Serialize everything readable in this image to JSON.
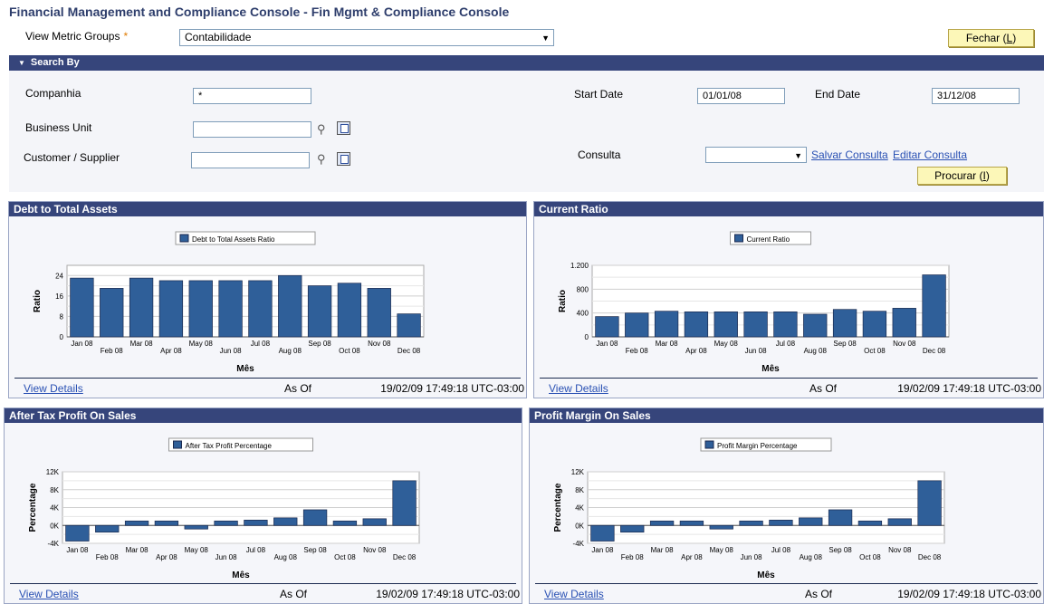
{
  "page_title": "Financial Management and Compliance Console - Fin Mgmt & Compliance Console",
  "metric_groups": {
    "label": "View Metric Groups",
    "required_mark": "*",
    "selected": "Contabilidade"
  },
  "close_button": {
    "label": "Fechar (",
    "key": "L",
    "suffix": ")"
  },
  "search": {
    "header": "Search By",
    "companhia_label": "Companhia",
    "companhia_value": "*",
    "business_unit_label": "Business Unit",
    "business_unit_value": "",
    "customer_label": "Customer / Supplier",
    "customer_value": "",
    "start_date_label": "Start Date",
    "start_date_value": "01/01/08",
    "end_date_label": "End Date",
    "end_date_value": "31/12/08",
    "consulta_label": "Consulta",
    "consulta_value": "",
    "save_query": "Salvar Consulta",
    "edit_query": "Editar Consulta",
    "search_button": {
      "label": "Procurar (",
      "key": "I",
      "suffix": ")"
    }
  },
  "icons": {
    "lookup": "magnifier-icon",
    "edit": "edit-icon",
    "dropdown": "chevron-down-icon",
    "collapse": "triangle-down-icon"
  },
  "colors": {
    "header_bg": "#36457b",
    "bar": "#2f5f99",
    "button_bg": "#fcf7b8",
    "link": "#2950b3"
  },
  "chart_data": [
    {
      "type": "bar",
      "title": "Debt to Total Assets",
      "legend": "Debt to Total Assets Ratio",
      "xlabel": "Mês",
      "ylabel": "Ratio",
      "categories": [
        "Jan 08",
        "Feb 08",
        "Mar 08",
        "Apr 08",
        "May 08",
        "Jun 08",
        "Jul 08",
        "Aug 08",
        "Sep 08",
        "Oct 08",
        "Nov 08",
        "Dec 08"
      ],
      "values": [
        23,
        19,
        23,
        22,
        22,
        22,
        22,
        24,
        20,
        21,
        19,
        9
      ],
      "ylim": [
        0,
        28
      ],
      "yticks": [
        "0",
        "8",
        "16",
        "24"
      ],
      "ytick_values": [
        0,
        8,
        16,
        24
      ],
      "view_details": "View Details",
      "as_of": "As Of",
      "timestamp": "19/02/09 17:49:18 UTC-03:00"
    },
    {
      "type": "bar",
      "title": "Current Ratio",
      "legend": "Current Ratio",
      "xlabel": "Mês",
      "ylabel": "Ratio",
      "categories": [
        "Jan 08",
        "Feb 08",
        "Mar 08",
        "Apr 08",
        "May 08",
        "Jun 08",
        "Jul 08",
        "Aug 08",
        "Sep 08",
        "Oct 08",
        "Nov 08",
        "Dec 08"
      ],
      "values": [
        340,
        400,
        430,
        420,
        420,
        420,
        420,
        380,
        460,
        430,
        480,
        1040
      ],
      "ylim": [
        0,
        1200
      ],
      "yticks": [
        "0",
        "400",
        "800",
        "1.200"
      ],
      "ytick_values": [
        0,
        400,
        800,
        1200
      ],
      "view_details": "View Details",
      "as_of": "As Of",
      "timestamp": "19/02/09 17:49:18 UTC-03:00"
    },
    {
      "type": "bar",
      "title": "After Tax Profit On Sales",
      "legend": "After Tax Profit Percentage",
      "xlabel": "Mês",
      "ylabel": "Percentage",
      "categories": [
        "Jan 08",
        "Feb 08",
        "Mar 08",
        "Apr 08",
        "May 08",
        "Jun 08",
        "Jul 08",
        "Aug 08",
        "Sep 08",
        "Oct 08",
        "Nov 08",
        "Dec 08"
      ],
      "values": [
        -3500,
        -1500,
        1000,
        1000,
        -800,
        1000,
        1200,
        1700,
        3500,
        1000,
        1500,
        10000
      ],
      "ylim": [
        -4000,
        12000
      ],
      "yticks": [
        "-4K",
        "0K",
        "4K",
        "8K",
        "12K"
      ],
      "ytick_values": [
        -4000,
        0,
        4000,
        8000,
        12000
      ],
      "view_details": "View Details",
      "as_of": "As Of",
      "timestamp": "19/02/09 17:49:18 UTC-03:00"
    },
    {
      "type": "bar",
      "title": "Profit Margin On Sales",
      "legend": "Profit Margin Percentage",
      "xlabel": "Mês",
      "ylabel": "Percentage",
      "categories": [
        "Jan 08",
        "Feb 08",
        "Mar 08",
        "Apr 08",
        "May 08",
        "Jun 08",
        "Jul 08",
        "Aug 08",
        "Sep 08",
        "Oct 08",
        "Nov 08",
        "Dec 08"
      ],
      "values": [
        -3500,
        -1500,
        1000,
        1000,
        -800,
        1000,
        1200,
        1700,
        3500,
        1000,
        1500,
        10000
      ],
      "ylim": [
        -4000,
        12000
      ],
      "yticks": [
        "-4K",
        "0K",
        "4K",
        "8K",
        "12K"
      ],
      "ytick_values": [
        -4000,
        0,
        4000,
        8000,
        12000
      ],
      "view_details": "View Details",
      "as_of": "As Of",
      "timestamp": "19/02/09 17:49:18 UTC-03:00"
    }
  ]
}
